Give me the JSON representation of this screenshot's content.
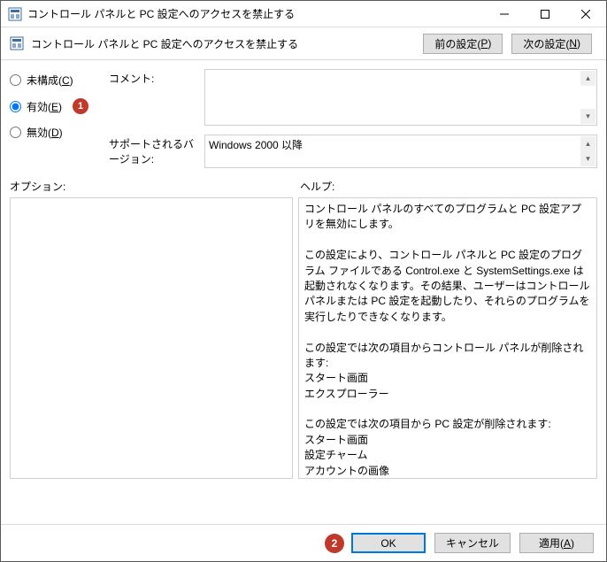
{
  "window": {
    "title": "コントロール パネルと PC 設定へのアクセスを禁止する"
  },
  "header": {
    "title": "コントロール パネルと PC 設定へのアクセスを禁止する",
    "prev_btn": "前の設定(",
    "prev_key": "P",
    "next_btn": "次の設定(",
    "next_key": "N",
    "paren_close": ")"
  },
  "radios": {
    "not_configured": "未構成(",
    "not_configured_key": "C",
    "enabled": "有効(",
    "enabled_key": "E",
    "disabled": "無効(",
    "disabled_key": "D",
    "paren_close": ")"
  },
  "badges": {
    "one": "1",
    "two": "2"
  },
  "fields": {
    "comment_label": "コメント:",
    "supported_label": "サポートされるバージョン:",
    "supported_value": "Windows 2000 以降"
  },
  "sections": {
    "options_label": "オプション:",
    "help_label": "ヘルプ:"
  },
  "help_text": "コントロール パネルのすべてのプログラムと PC 設定アプリを無効にします。\n\nこの設定により、コントロール パネルと PC 設定のプログラム ファイルである Control.exe と SystemSettings.exe は起動されなくなります。その結果、ユーザーはコントロール パネルまたは PC 設定を起動したり、それらのプログラムを実行したりできなくなります。\n\nこの設定では次の項目からコントロール パネルが削除されます:\nスタート画面\nエクスプローラー\n\nこの設定では次の項目から PC 設定が削除されます:\nスタート画面\n設定チャーム\nアカウントの画像\n検索結果\n\nユーザーがショートカット メニューのプロパティ項目からコントロール パネルのプログラムを開始しようとすると、設定によって禁止されているという内容のメッセージが表示されます。",
  "buttons": {
    "ok": "OK",
    "cancel": "キャンセル",
    "apply": "適用(",
    "apply_key": "A",
    "paren_close": ")"
  }
}
